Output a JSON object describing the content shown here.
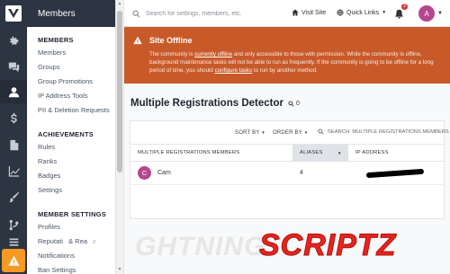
{
  "nav": {
    "header_title": "Members",
    "sections": [
      {
        "title": "MEMBERS",
        "items": [
          "Members",
          "Groups",
          "Group Promotions",
          "IP Address Tools",
          "PII & Deletion Requests"
        ]
      },
      {
        "title": "ACHIEVEMENTS",
        "items": [
          "Rules",
          "Ranks",
          "Badges",
          "Settings"
        ]
      },
      {
        "title": "MEMBER SETTINGS",
        "items": [
          "Profiles",
          "Reputati   & Rea",
          "Notifications",
          "Ban Settings"
        ]
      }
    ],
    "obscured_badge": "2"
  },
  "topbar": {
    "search_placeholder": "Search for settings, members, etc.",
    "visit_site": "Visit Site",
    "quick_links": "Quick Links",
    "notification_count": "2",
    "user_initial": "A"
  },
  "alert": {
    "title": "Site Offline",
    "text_before_link1": "The community is ",
    "link1": "currently offline",
    "text_mid": " and only accessible to those with permission. While the community is offline, background maintenance tasks will not be able to run as frequently. If the community is going to be offline for a long period of time, you should ",
    "link2": "configure tasks",
    "text_after": " to run by another method."
  },
  "page": {
    "title": "Multiple Registrations Detector",
    "search_count": "0"
  },
  "table": {
    "sort_by": "SORT BY",
    "order_by": "ORDER BY",
    "search_label": "SEARCH: MULTIPLE REGISTRATIONS MEMBERS",
    "columns": [
      "MULTIPLE REGISTRATIONS MEMBERS",
      "ALIASES",
      "IP ADDRESS"
    ],
    "rows": [
      {
        "initial": "C",
        "name": "Cam",
        "aliases": "4",
        "ip": ""
      }
    ]
  },
  "watermark": {
    "light_text": "GHTNING",
    "red_text": "SCRIPTZ"
  },
  "colors": {
    "rail_bg": "#2d3442",
    "alert_bg": "#c85a2a",
    "avatar": "#b5478f",
    "warning_button": "#f59a23"
  },
  "icons": [
    "logo-icon",
    "gear-icon",
    "chat-icon",
    "user-icon",
    "dollar-icon",
    "document-icon",
    "chart-icon",
    "brush-icon",
    "fork-icon",
    "menu-icon",
    "warning-icon"
  ]
}
